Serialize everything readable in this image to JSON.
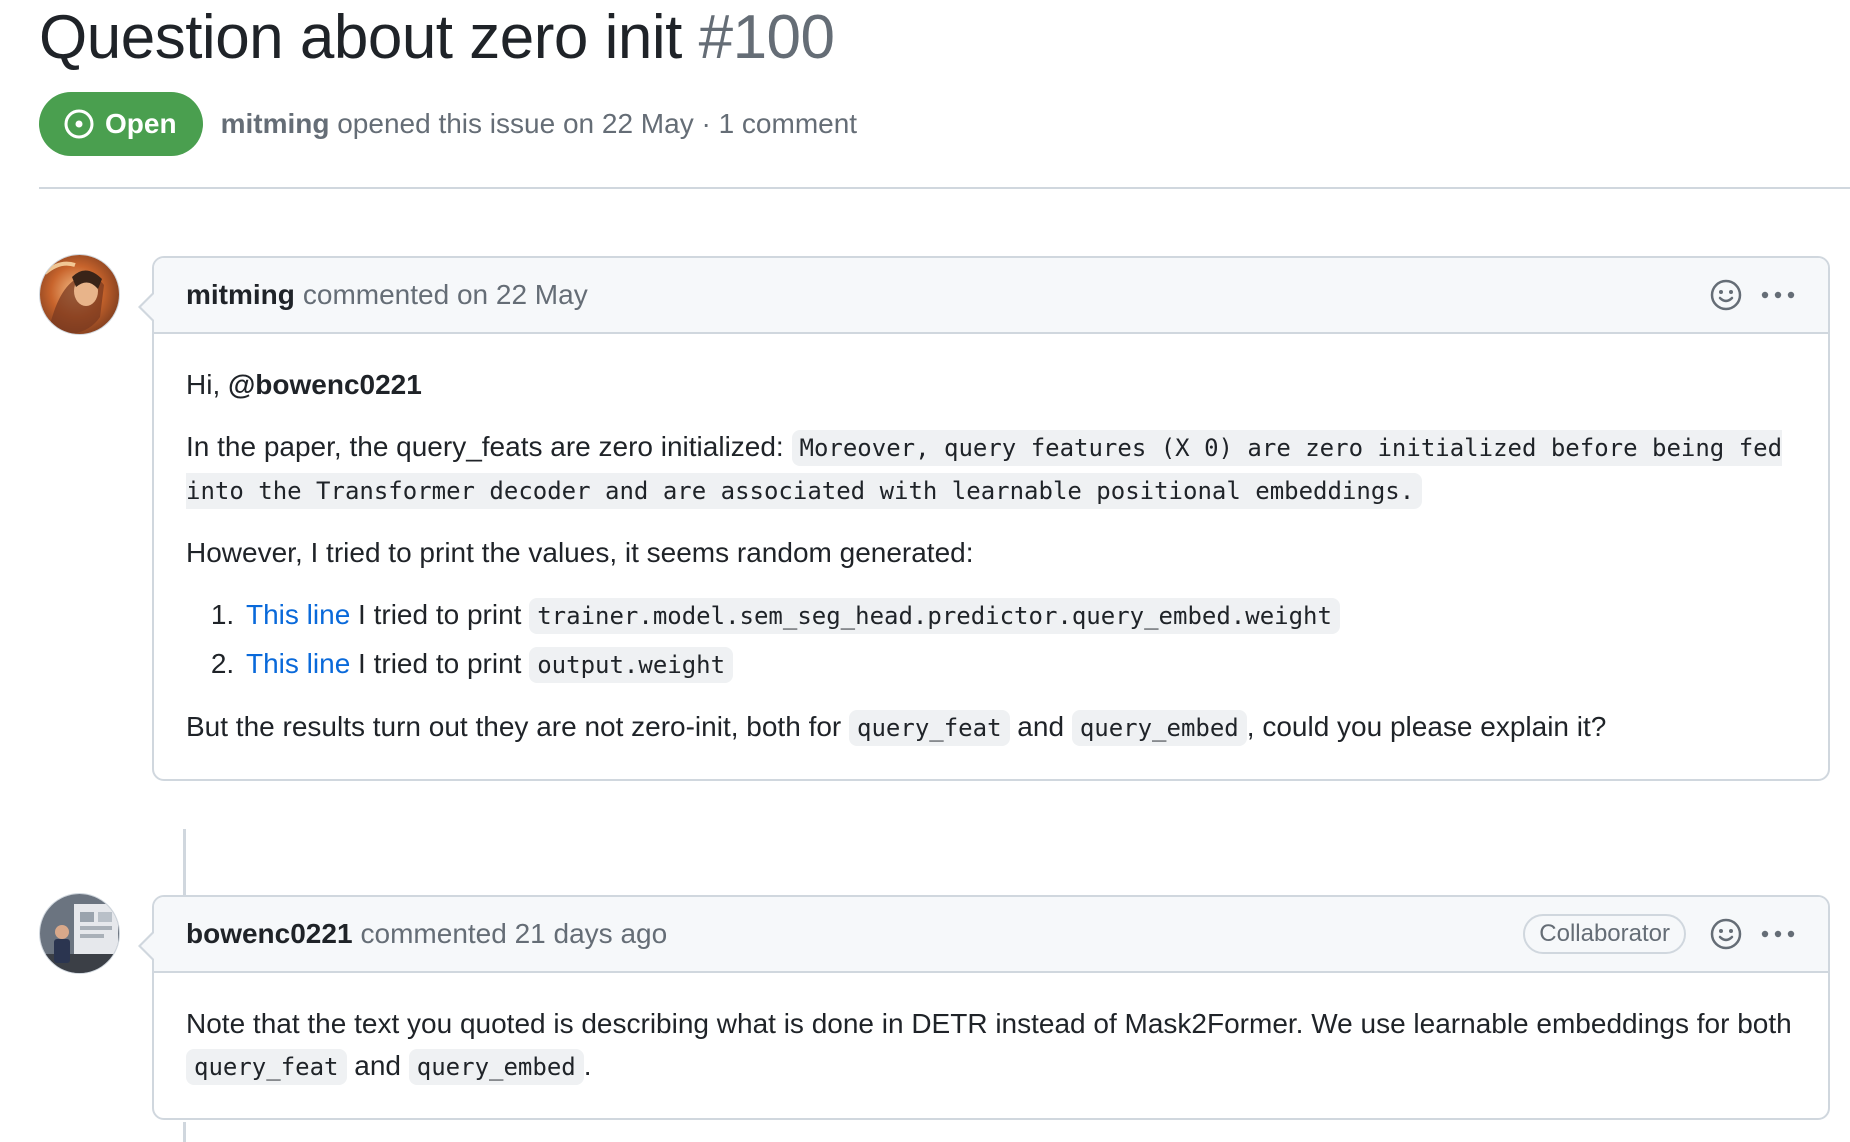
{
  "issue": {
    "title": "Question about zero init",
    "number": "#100",
    "state": "Open",
    "author": "mitming",
    "opened_text": "opened this issue on 22 May · 1 comment"
  },
  "comments": [
    {
      "author": "mitming",
      "action": "commented on 22 May",
      "greeting_prefix": "Hi, ",
      "mention": "@bowenc0221",
      "para1_text": "In the paper, the query_feats are zero initialized: ",
      "para1_code": "Moreover, query features (X 0) are zero initialized before being fed into the Transformer decoder and are associated with learnable positional embeddings.",
      "para2_text": "However, I tried to print the values, it seems random generated:",
      "list": [
        {
          "link": "This line",
          "text": " I tried to print ",
          "code": "trainer.model.sem_seg_head.predictor.query_embed.weight"
        },
        {
          "link": "This line",
          "text": " I tried to print ",
          "code": "output.weight"
        }
      ],
      "para3_a": "But the results turn out they are not zero-init, both for ",
      "para3_code1": "query_feat",
      "para3_b": " and ",
      "para3_code2": "query_embed",
      "para3_c": ", could you please explain it?"
    },
    {
      "author": "bowenc0221",
      "action": "commented 21 days ago",
      "badge": "Collaborator",
      "body_a": "Note that the text you quoted is describing what is done in DETR instead of Mask2Former. We use learnable embeddings for both ",
      "body_code1": "query_feat",
      "body_b": " and ",
      "body_code2": "query_embed",
      "body_c": "."
    }
  ],
  "colors": {
    "open_green": "#4a9f4f",
    "link_blue": "#0969da",
    "border": "#d0d7de",
    "header_bg": "#f6f8fa"
  },
  "icons": [
    "issue-opened-icon",
    "smiley-icon",
    "kebab-horizontal-icon"
  ]
}
